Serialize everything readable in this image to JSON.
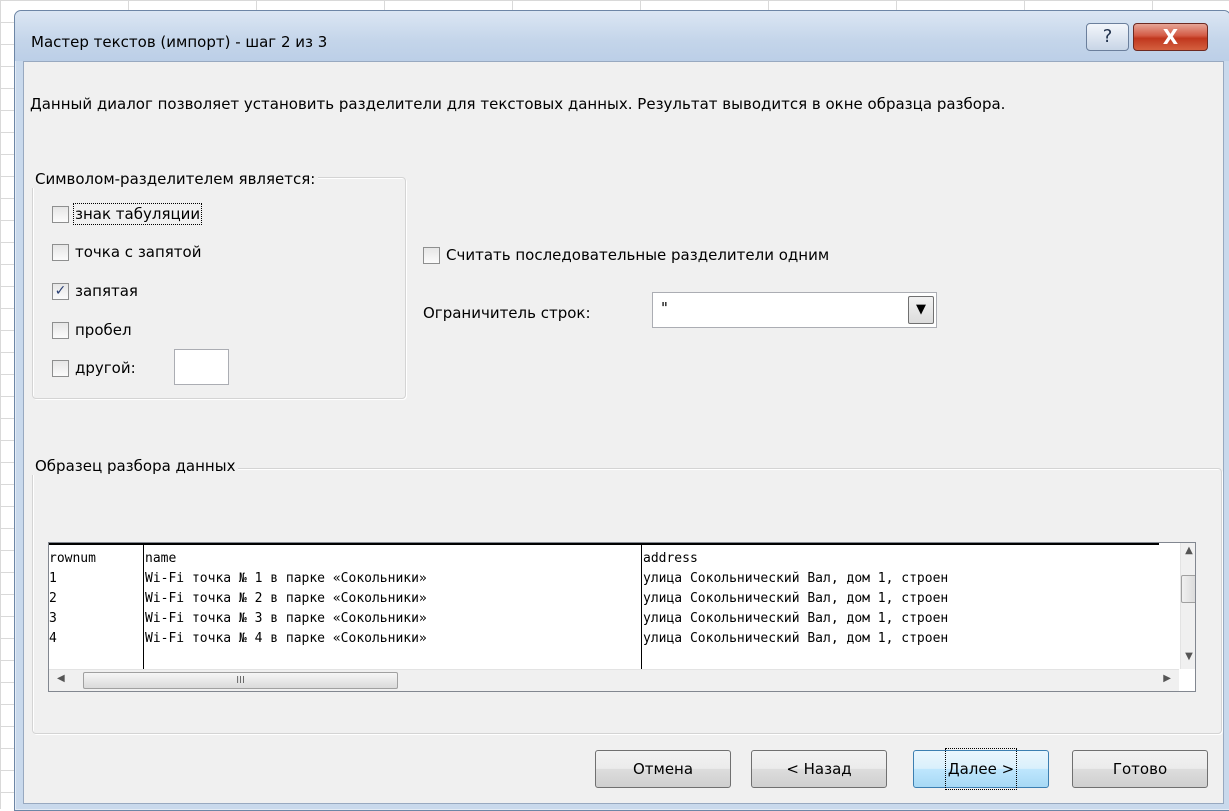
{
  "window": {
    "title": "Мастер текстов (импорт) - шаг 2 из 3",
    "help_label": "?",
    "close_label": "X"
  },
  "description": "Данный диалог позволяет установить разделители для текстовых данных. Результат выводится в окне образца разбора.",
  "delimiters": {
    "group_title": "Символом-разделителем является:",
    "items": [
      {
        "label": "знак табуляции",
        "checked": false
      },
      {
        "label": "точка с запятой",
        "checked": false
      },
      {
        "label": "запятая",
        "checked": true
      },
      {
        "label": "пробел",
        "checked": false
      },
      {
        "label": "другой:",
        "checked": false
      }
    ],
    "other_value": ""
  },
  "options": {
    "consecutive_label": "Считать последовательные разделители одним",
    "consecutive_checked": false,
    "qualifier_label": "Ограничитель строк:",
    "qualifier_value": "\""
  },
  "preview": {
    "group_title": "Образец разбора данных",
    "columns": [
      "rownum",
      "name",
      "address"
    ],
    "rows": [
      [
        "1",
        "Wi-Fi точка № 1 в парке «Сокольники»",
        "улица Сокольнический Вал, дом 1, строен"
      ],
      [
        "2",
        "Wi-Fi точка № 2 в парке «Сокольники»",
        "улица Сокольнический Вал, дом 1, строен"
      ],
      [
        "3",
        "Wi-Fi точка № 3 в парке «Сокольники»",
        "улица Сокольнический Вал, дом 1, строен"
      ],
      [
        "4",
        "Wi-Fi точка № 4 в парке «Сокольники»",
        "улица Сокольнический Вал, дом 1, строен"
      ]
    ]
  },
  "buttons": {
    "cancel": "Отмена",
    "back": "< Назад",
    "next": "Далее >",
    "finish": "Готово"
  }
}
